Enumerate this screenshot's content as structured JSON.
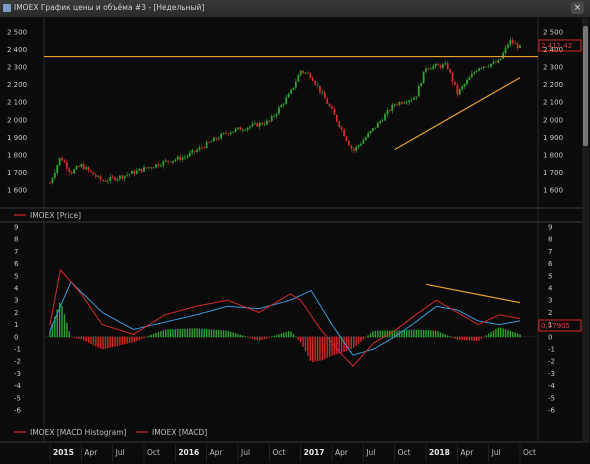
{
  "window": {
    "title": "IMOEX График цены и объёма #3 - [Недельный]",
    "close_glyph": "×"
  },
  "colors": {
    "up": "#2fa52f",
    "down": "#d42a2a",
    "macd": "#d42a2a",
    "signal": "#3a9ad9",
    "trendline": "#e8a030",
    "last_price_box": "#d42a2a"
  },
  "price_panel": {
    "y_ticks": [
      "2 500",
      "2 400",
      "2 300",
      "2 200",
      "2 100",
      "2 000",
      "1 900",
      "1 800",
      "1 700",
      "1 600"
    ],
    "last_price": "2 411,42",
    "legend": "IMOEX [Price]"
  },
  "macd_panel": {
    "y_ticks": [
      "9",
      "8",
      "7",
      "6",
      "5",
      "4",
      "3",
      "2",
      "1",
      "0",
      "-1",
      "-2",
      "-3",
      "-4",
      "-5",
      "-6"
    ],
    "last_value": "0,57905",
    "legend_hist": "IMOEX [MACD Histogram]",
    "legend_macd": "IMOEX [MACD]"
  },
  "time_axis": {
    "labels": [
      {
        "text": "2015",
        "year": true
      },
      {
        "text": "Apr",
        "year": false
      },
      {
        "text": "Jul",
        "year": false
      },
      {
        "text": "Oct",
        "year": false
      },
      {
        "text": "2016",
        "year": true
      },
      {
        "text": "Apr",
        "year": false
      },
      {
        "text": "Jul",
        "year": false
      },
      {
        "text": "Oct",
        "year": false
      },
      {
        "text": "2017",
        "year": true
      },
      {
        "text": "Apr",
        "year": false
      },
      {
        "text": "Jul",
        "year": false
      },
      {
        "text": "Oct",
        "year": false
      },
      {
        "text": "2018",
        "year": true
      },
      {
        "text": "Apr",
        "year": false
      },
      {
        "text": "Jul",
        "year": false
      },
      {
        "text": "Oct",
        "year": false
      }
    ]
  },
  "chart_data": {
    "type": "candlestick",
    "price_path": [
      [
        "2015-01",
        1640
      ],
      [
        "2015-02",
        1790
      ],
      [
        "2015-03",
        1700
      ],
      [
        "2015-04",
        1740
      ],
      [
        "2015-06",
        1650
      ],
      [
        "2015-08",
        1680
      ],
      [
        "2015-10",
        1720
      ],
      [
        "2015-12",
        1760
      ],
      [
        "2016-02",
        1790
      ],
      [
        "2016-04",
        1860
      ],
      [
        "2016-06",
        1930
      ],
      [
        "2016-08",
        1960
      ],
      [
        "2016-10",
        1990
      ],
      [
        "2016-12",
        2150
      ],
      [
        "2017-01",
        2280
      ],
      [
        "2017-02",
        2250
      ],
      [
        "2017-04",
        2050
      ],
      [
        "2017-06",
        1820
      ],
      [
        "2017-08",
        1950
      ],
      [
        "2017-10",
        2090
      ],
      [
        "2017-12",
        2130
      ],
      [
        "2018-01",
        2300
      ],
      [
        "2018-03",
        2310
      ],
      [
        "2018-04",
        2150
      ],
      [
        "2018-06",
        2300
      ],
      [
        "2018-08",
        2330
      ],
      [
        "2018-09",
        2450
      ],
      [
        "2018-10",
        2411
      ]
    ],
    "macd_path": [
      [
        "2015-01",
        1.0
      ],
      [
        "2015-02",
        5.5
      ],
      [
        "2015-04",
        3.5
      ],
      [
        "2015-06",
        1.0
      ],
      [
        "2015-09",
        0.2
      ],
      [
        "2015-12",
        1.8
      ],
      [
        "2016-03",
        2.5
      ],
      [
        "2016-06",
        3.0
      ],
      [
        "2016-09",
        2.0
      ],
      [
        "2016-12",
        3.5
      ],
      [
        "2017-01",
        3.0
      ],
      [
        "2017-03",
        0.5
      ],
      [
        "2017-05",
        -1.5
      ],
      [
        "2017-06",
        -2.4
      ],
      [
        "2017-08",
        -0.5
      ],
      [
        "2017-10",
        0.5
      ],
      [
        "2017-12",
        1.8
      ],
      [
        "2018-02",
        3.0
      ],
      [
        "2018-04",
        2.0
      ],
      [
        "2018-06",
        1.0
      ],
      [
        "2018-08",
        1.8
      ],
      [
        "2018-10",
        1.5
      ]
    ],
    "signal_path": [
      [
        "2015-01",
        0.5
      ],
      [
        "2015-03",
        4.5
      ],
      [
        "2015-06",
        2.0
      ],
      [
        "2015-09",
        0.6
      ],
      [
        "2015-12",
        1.2
      ],
      [
        "2016-03",
        1.8
      ],
      [
        "2016-06",
        2.5
      ],
      [
        "2016-09",
        2.3
      ],
      [
        "2016-12",
        3.0
      ],
      [
        "2017-02",
        3.8
      ],
      [
        "2017-04",
        1.0
      ],
      [
        "2017-06",
        -1.5
      ],
      [
        "2017-08",
        -1.0
      ],
      [
        "2017-10",
        0.0
      ],
      [
        "2017-12",
        1.2
      ],
      [
        "2018-02",
        2.5
      ],
      [
        "2018-04",
        2.2
      ],
      [
        "2018-06",
        1.3
      ],
      [
        "2018-08",
        1.0
      ],
      [
        "2018-10",
        1.3
      ]
    ],
    "horizontal_resistance": 2360,
    "price_trendline": [
      [
        "2017-10",
        1830
      ],
      [
        "2018-10",
        2240
      ]
    ],
    "macd_trendline": [
      [
        "2018-01",
        4.3
      ],
      [
        "2018-10",
        2.8
      ]
    ],
    "price_range": [
      1600,
      2520
    ],
    "macd_range": [
      -6.5,
      9
    ]
  }
}
